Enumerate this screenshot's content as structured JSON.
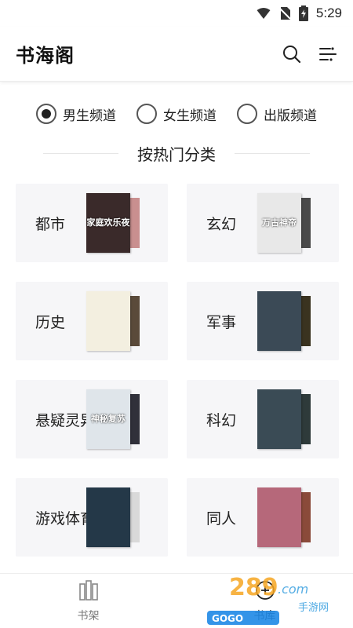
{
  "status_bar": {
    "time": "5:29"
  },
  "header": {
    "title": "书海阁"
  },
  "channels": [
    {
      "label": "男生频道",
      "checked": true
    },
    {
      "label": "女生频道",
      "checked": false
    },
    {
      "label": "出版频道",
      "checked": false
    }
  ],
  "section_title": "按热门分类",
  "categories": [
    {
      "label": "都市",
      "cover_title": "家庭欢乐夜",
      "front_color": "#3a2a2a",
      "back_color": "#c98f8f"
    },
    {
      "label": "玄幻",
      "cover_title": "万古神帝",
      "front_color": "#e8e8e8",
      "back_color": "#4a4a4a"
    },
    {
      "label": "历史",
      "cover_title": "",
      "front_color": "#f3efe0",
      "back_color": "#5a4a3a"
    },
    {
      "label": "军事",
      "cover_title": "",
      "front_color": "#3b4a56",
      "back_color": "#3a3320"
    },
    {
      "label": "悬疑灵异",
      "cover_title": "神秘复苏",
      "front_color": "#dfe5ea",
      "back_color": "#30303a"
    },
    {
      "label": "科幻",
      "cover_title": "",
      "front_color": "#3a4b55",
      "back_color": "#2e3a3a"
    },
    {
      "label": "游戏体育",
      "cover_title": "",
      "front_color": "#243848",
      "back_color": "#d9d9d9"
    },
    {
      "label": "同人",
      "cover_title": "",
      "front_color": "#b6687a",
      "back_color": "#8a4a3a"
    }
  ],
  "bottom_nav": [
    {
      "label": "书架",
      "icon": "bookshelf-icon",
      "active": false
    },
    {
      "label": "书库",
      "icon": "library-icon",
      "active": true
    }
  ],
  "watermark": {
    "logo_text": "289.com",
    "sub_text": "手游网",
    "brand": "GOGO"
  }
}
